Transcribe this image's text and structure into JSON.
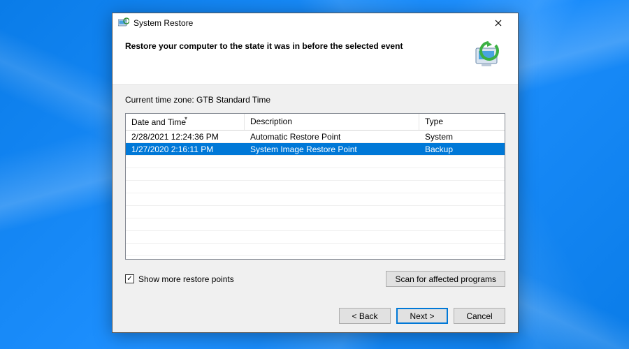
{
  "window": {
    "title": "System Restore"
  },
  "header": {
    "heading": "Restore your computer to the state it was in before the selected event"
  },
  "body": {
    "timezone_label": "Current time zone: GTB Standard Time",
    "columns": {
      "date": "Date and Time",
      "description": "Description",
      "type": "Type"
    },
    "rows": [
      {
        "date": "2/28/2021 12:24:36 PM",
        "description": "Automatic Restore Point",
        "type": "System",
        "selected": false
      },
      {
        "date": "1/27/2020 2:16:11 PM",
        "description": "System Image Restore Point",
        "type": "Backup",
        "selected": true
      }
    ],
    "show_more_label": "Show more restore points",
    "show_more_checked": true,
    "scan_button": "Scan for affected programs"
  },
  "footer": {
    "back": "< Back",
    "next": "Next >",
    "cancel": "Cancel"
  }
}
